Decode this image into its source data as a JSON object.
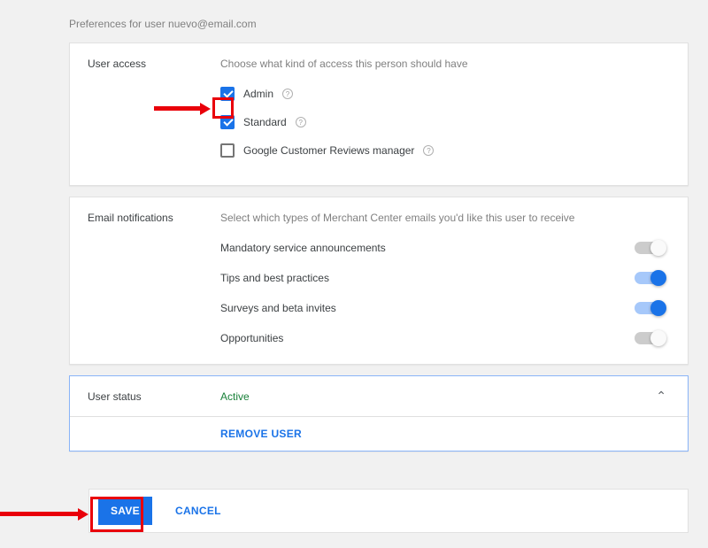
{
  "page_title": "Preferences for user nuevo@email.com",
  "user_access": {
    "label": "User access",
    "desc": "Choose what kind of access this person should have",
    "options": [
      {
        "label": "Admin",
        "checked": true,
        "help": true
      },
      {
        "label": "Standard",
        "checked": true,
        "help": true
      },
      {
        "label": "Google Customer Reviews manager",
        "checked": false,
        "help": true
      }
    ]
  },
  "email_notifications": {
    "label": "Email notifications",
    "desc": "Select which types of Merchant Center emails you'd like this user to receive",
    "items": [
      {
        "label": "Mandatory service announcements",
        "on": false
      },
      {
        "label": "Tips and best practices",
        "on": true
      },
      {
        "label": "Surveys and beta invites",
        "on": true
      },
      {
        "label": "Opportunities",
        "on": false
      }
    ]
  },
  "user_status": {
    "label": "User status",
    "value": "Active",
    "remove_label": "REMOVE USER"
  },
  "actions": {
    "save": "SAVE",
    "cancel": "CANCEL"
  }
}
